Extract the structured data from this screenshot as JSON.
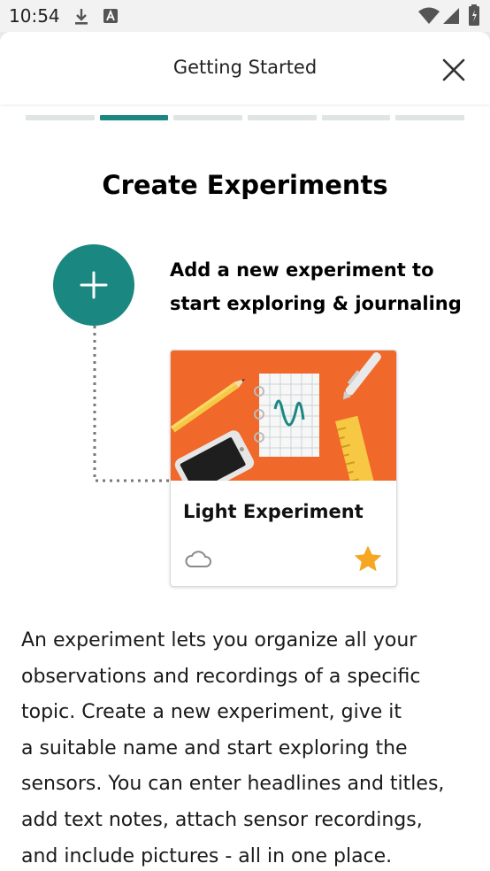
{
  "status_bar": {
    "time": "10:54",
    "icons": [
      "download-icon",
      "a-badge-icon",
      "wifi-icon",
      "signal-icon",
      "battery-icon"
    ]
  },
  "dialog": {
    "title": "Getting Started",
    "close_icon": "close-icon"
  },
  "progress": {
    "total_steps": 6,
    "current_step": 2
  },
  "content": {
    "heading": "Create Experiments",
    "add_button_icon": "plus-icon",
    "callout_line1": "Add a new experiment to",
    "callout_line2": "start exploring & journaling",
    "card": {
      "title": "Light Experiment",
      "cloud_icon": "cloud-icon",
      "star_icon": "star-icon"
    },
    "body_lines": [
      "An experiment lets you organize all your",
      "observations and recordings of a specific",
      "topic. Create a new experiment, give it",
      "a suitable name and start exploring the",
      "sensors. You can enter headlines and titles,",
      "add text notes, attach sensor recordings,",
      "and include pictures - all in one place."
    ]
  },
  "colors": {
    "accent": "#1b8781",
    "card_image_bg": "#f0692a",
    "star": "#f5a623",
    "progress_inactive": "#dfe4e4"
  }
}
